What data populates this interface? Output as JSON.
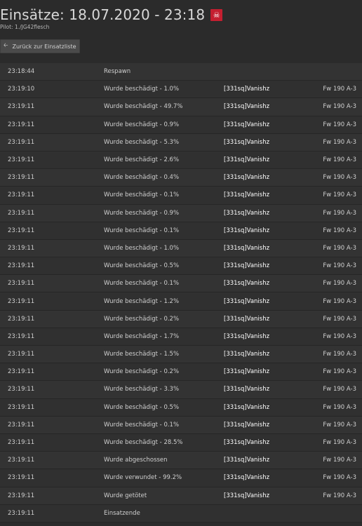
{
  "header": {
    "title": "Einsätze: 18.07.2020 - 23:18",
    "badge_icon": "skull-icon",
    "badge_color": "#c41f30",
    "pilot": "Pilot: 1./JG42flesch"
  },
  "back_button": {
    "label": "Zurück zur Einsatzliste",
    "icon": "arrow-left-icon"
  },
  "events": [
    {
      "time": "23:18:44",
      "event": "Respawn",
      "player": "",
      "plane": ""
    },
    {
      "time": "23:19:10",
      "event": "Wurde beschädigt - 1.0%",
      "player": "[331sq]Vanishz",
      "plane": "Fw 190 A-3"
    },
    {
      "time": "23:19:11",
      "event": "Wurde beschädigt - 49.7%",
      "player": "[331sq]Vanishz",
      "plane": "Fw 190 A-3"
    },
    {
      "time": "23:19:11",
      "event": "Wurde beschädigt - 0.9%",
      "player": "[331sq]Vanishz",
      "plane": "Fw 190 A-3"
    },
    {
      "time": "23:19:11",
      "event": "Wurde beschädigt - 5.3%",
      "player": "[331sq]Vanishz",
      "plane": "Fw 190 A-3"
    },
    {
      "time": "23:19:11",
      "event": "Wurde beschädigt - 2.6%",
      "player": "[331sq]Vanishz",
      "plane": "Fw 190 A-3"
    },
    {
      "time": "23:19:11",
      "event": "Wurde beschädigt - 0.4%",
      "player": "[331sq]Vanishz",
      "plane": "Fw 190 A-3"
    },
    {
      "time": "23:19:11",
      "event": "Wurde beschädigt - 0.1%",
      "player": "[331sq]Vanishz",
      "plane": "Fw 190 A-3"
    },
    {
      "time": "23:19:11",
      "event": "Wurde beschädigt - 0.9%",
      "player": "[331sq]Vanishz",
      "plane": "Fw 190 A-3"
    },
    {
      "time": "23:19:11",
      "event": "Wurde beschädigt - 0.1%",
      "player": "[331sq]Vanishz",
      "plane": "Fw 190 A-3"
    },
    {
      "time": "23:19:11",
      "event": "Wurde beschädigt - 1.0%",
      "player": "[331sq]Vanishz",
      "plane": "Fw 190 A-3"
    },
    {
      "time": "23:19:11",
      "event": "Wurde beschädigt - 0.5%",
      "player": "[331sq]Vanishz",
      "plane": "Fw 190 A-3"
    },
    {
      "time": "23:19:11",
      "event": "Wurde beschädigt - 0.1%",
      "player": "[331sq]Vanishz",
      "plane": "Fw 190 A-3"
    },
    {
      "time": "23:19:11",
      "event": "Wurde beschädigt - 1.2%",
      "player": "[331sq]Vanishz",
      "plane": "Fw 190 A-3"
    },
    {
      "time": "23:19:11",
      "event": "Wurde beschädigt - 0.2%",
      "player": "[331sq]Vanishz",
      "plane": "Fw 190 A-3"
    },
    {
      "time": "23:19:11",
      "event": "Wurde beschädigt - 1.7%",
      "player": "[331sq]Vanishz",
      "plane": "Fw 190 A-3"
    },
    {
      "time": "23:19:11",
      "event": "Wurde beschädigt - 1.5%",
      "player": "[331sq]Vanishz",
      "plane": "Fw 190 A-3"
    },
    {
      "time": "23:19:11",
      "event": "Wurde beschädigt - 0.2%",
      "player": "[331sq]Vanishz",
      "plane": "Fw 190 A-3"
    },
    {
      "time": "23:19:11",
      "event": "Wurde beschädigt - 3.3%",
      "player": "[331sq]Vanishz",
      "plane": "Fw 190 A-3"
    },
    {
      "time": "23:19:11",
      "event": "Wurde beschädigt - 0.5%",
      "player": "[331sq]Vanishz",
      "plane": "Fw 190 A-3"
    },
    {
      "time": "23:19:11",
      "event": "Wurde beschädigt - 0.1%",
      "player": "[331sq]Vanishz",
      "plane": "Fw 190 A-3"
    },
    {
      "time": "23:19:11",
      "event": "Wurde beschädigt - 28.5%",
      "player": "[331sq]Vanishz",
      "plane": "Fw 190 A-3"
    },
    {
      "time": "23:19:11",
      "event": "Wurde abgeschossen",
      "player": "[331sq]Vanishz",
      "plane": "Fw 190 A-3"
    },
    {
      "time": "23:19:11",
      "event": "Wurde verwundet - 99.2%",
      "player": "[331sq]Vanishz",
      "plane": "Fw 190 A-3"
    },
    {
      "time": "23:19:11",
      "event": "Wurde getötet",
      "player": "[331sq]Vanishz",
      "plane": "Fw 190 A-3"
    },
    {
      "time": "23:19:11",
      "event": "Einsatzende",
      "player": "",
      "plane": ""
    }
  ]
}
